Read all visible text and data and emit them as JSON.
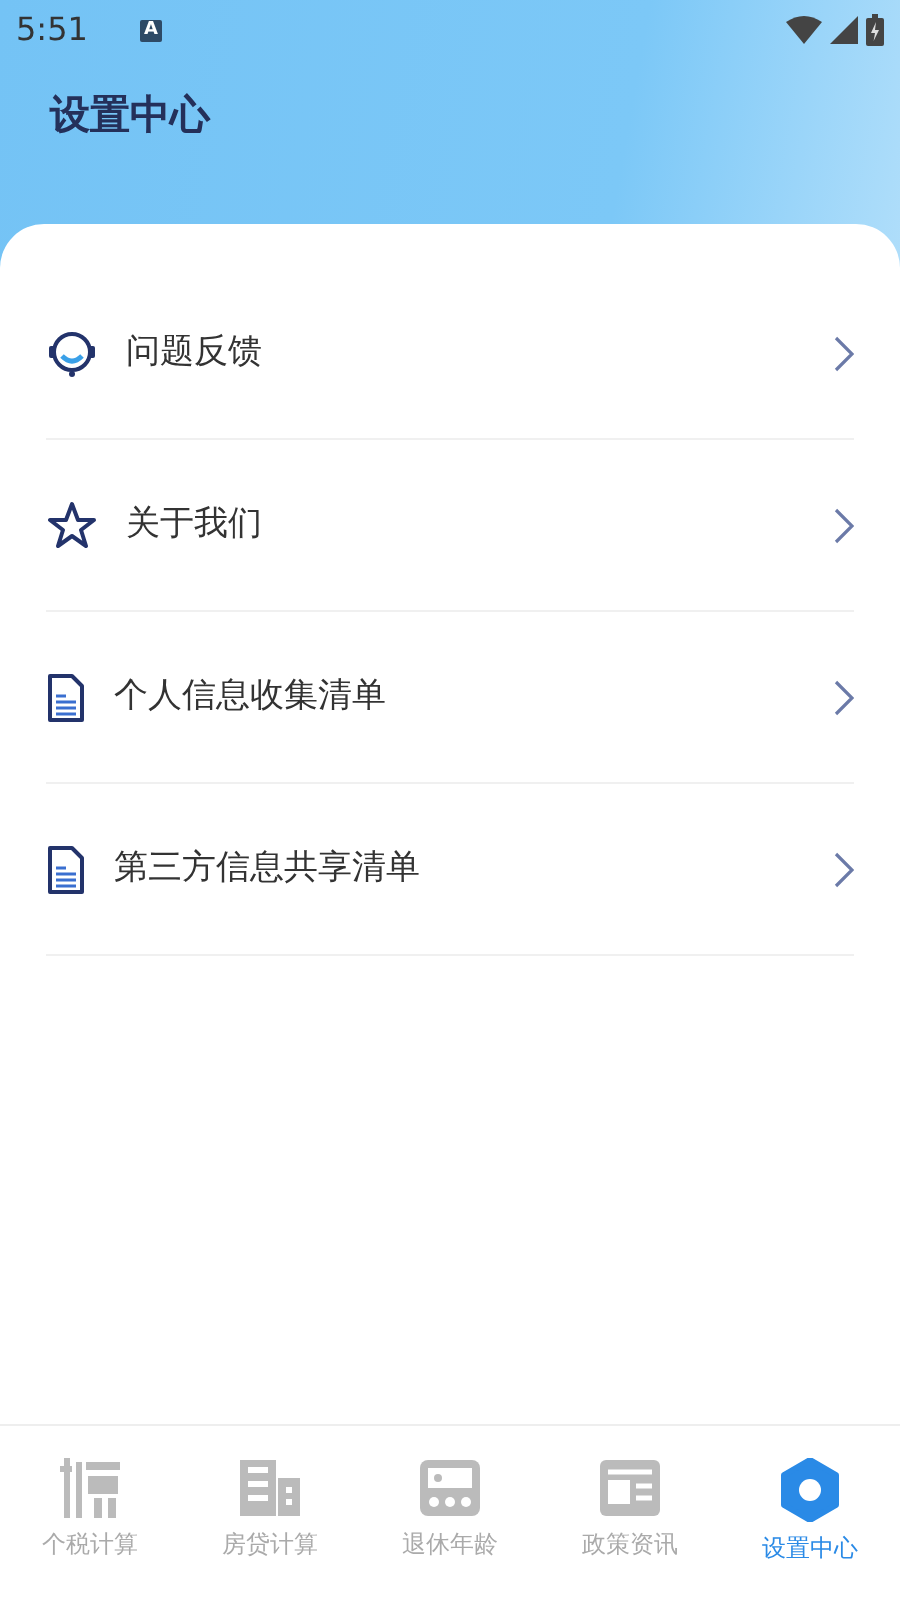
{
  "status_bar": {
    "time": "5:51",
    "notification": "A"
  },
  "title": "设置中心",
  "menu": [
    {
      "label": "问题反馈",
      "kind": "headset"
    },
    {
      "label": "关于我们",
      "kind": "star"
    },
    {
      "label": "个人信息收集清单",
      "kind": "doc"
    },
    {
      "label": "第三方信息共享清单",
      "kind": "doc"
    }
  ],
  "tab_bar": [
    {
      "label": "个税计算",
      "kind": "tax",
      "selected": false
    },
    {
      "label": "房贷计算",
      "kind": "building",
      "selected": false
    },
    {
      "label": "退休年龄",
      "kind": "card",
      "selected": false
    },
    {
      "label": "政策资讯",
      "kind": "news",
      "selected": false
    },
    {
      "label": "设置中心",
      "kind": "gear",
      "selected": true
    }
  ]
}
